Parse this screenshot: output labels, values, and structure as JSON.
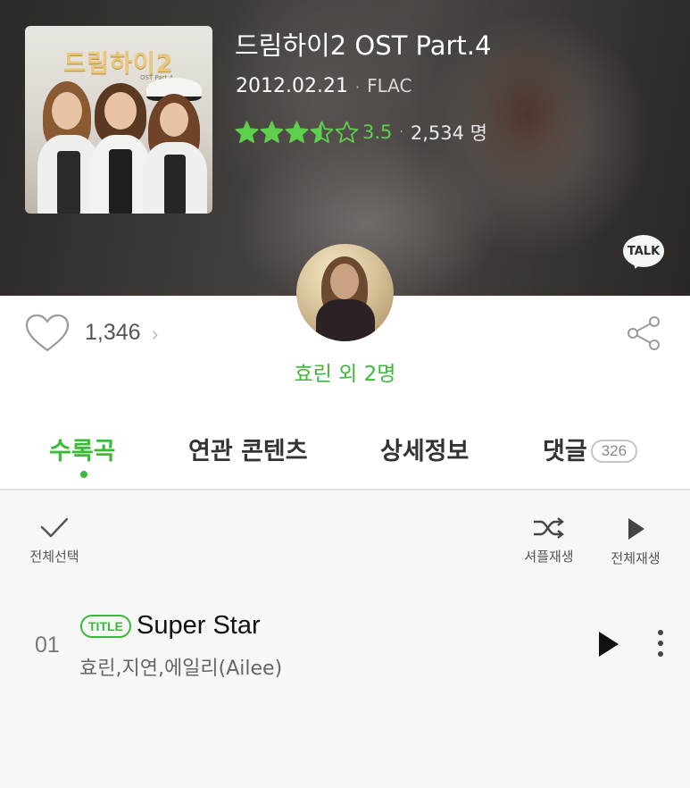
{
  "album": {
    "cover_title": "드림하이2",
    "cover_subtitle": "OST Part.4",
    "title": "드림하이2 OST Part.4",
    "release_date": "2012.02.21",
    "format": "FLAC",
    "rating_value": "3.5",
    "rating_stars": 3.5,
    "rating_count": "2,534 명"
  },
  "kakao_talk_label": "TALK",
  "likes": {
    "count": "1,346",
    "chevron": "›"
  },
  "artist": {
    "name": "효린 외 2명"
  },
  "tabs": [
    {
      "label": "수록곡",
      "active": true
    },
    {
      "label": "연관 콘텐츠",
      "active": false
    },
    {
      "label": "상세정보",
      "active": false
    },
    {
      "label": "댓글",
      "active": false,
      "badge": "326"
    }
  ],
  "toolbar": {
    "select_all_label": "전체선택",
    "shuffle_label": "셔플재생",
    "play_all_label": "전체재생"
  },
  "tracks": [
    {
      "number": "01",
      "badge": "TITLE",
      "title": "Super Star",
      "artists": "효린,지연,에일리(Ailee)"
    }
  ],
  "colors": {
    "accent": "#3cb93a",
    "star": "#5dd14d"
  }
}
